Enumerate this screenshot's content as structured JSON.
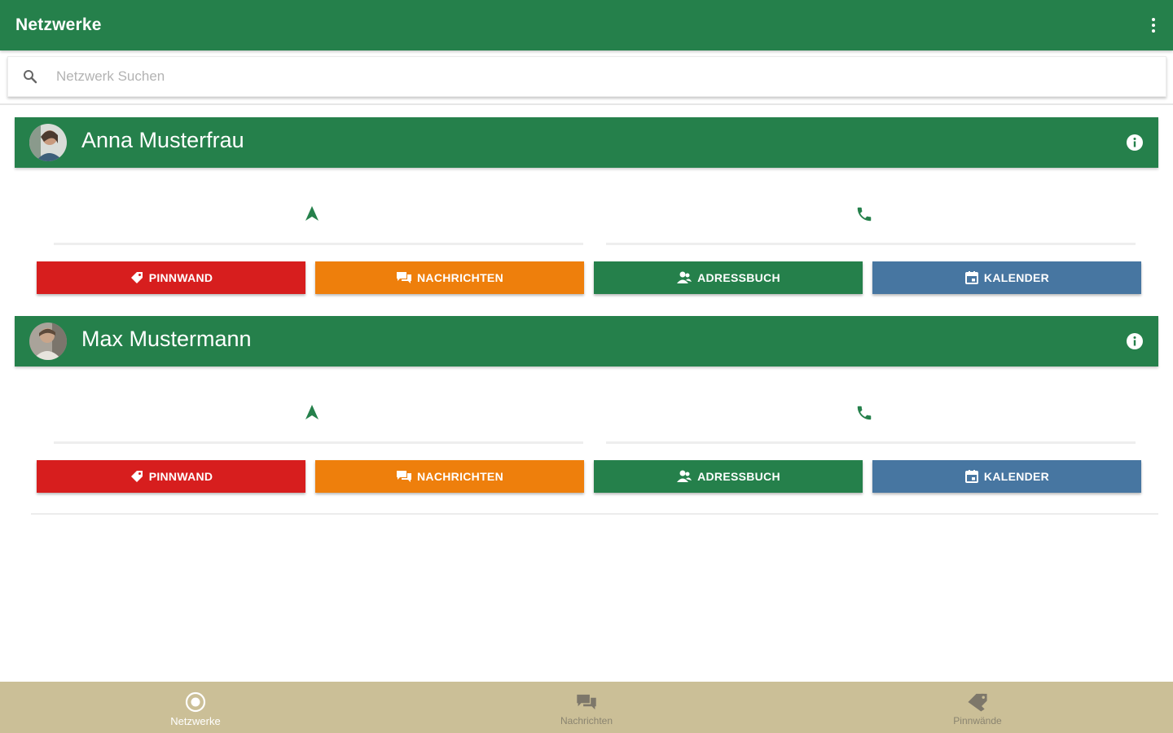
{
  "appbar": {
    "title": "Netzwerke"
  },
  "search": {
    "placeholder": "Netzwerk Suchen"
  },
  "networks": [
    {
      "name": "Anna Musterfrau"
    },
    {
      "name": "Max Mustermann"
    }
  ],
  "buttons": {
    "pinnwand": "PINNWAND",
    "nachrichten": "NACHRICHTEN",
    "adressbuch": "ADRESSBUCH",
    "kalender": "KALENDER"
  },
  "bottom_nav": {
    "items": [
      {
        "label": "Netzwerke",
        "active": true
      },
      {
        "label": "Nachrichten",
        "active": false
      },
      {
        "label": "Pinnwände",
        "active": false
      }
    ]
  },
  "colors": {
    "primary_green": "#25804b",
    "red": "#d71e1e",
    "orange": "#ee7f0c",
    "blue": "#4776a1",
    "bottom_nav_bg": "#cbbf97"
  },
  "icons": {
    "overflow": "more-vert-icon",
    "search": "search-icon",
    "info": "info-icon",
    "navigation": "navigation-arrow-icon",
    "phone": "phone-icon",
    "pinnwand": "tag-icon",
    "nachrichten": "chat-icon",
    "adressbuch": "contacts-icon",
    "kalender": "calendar-icon"
  }
}
